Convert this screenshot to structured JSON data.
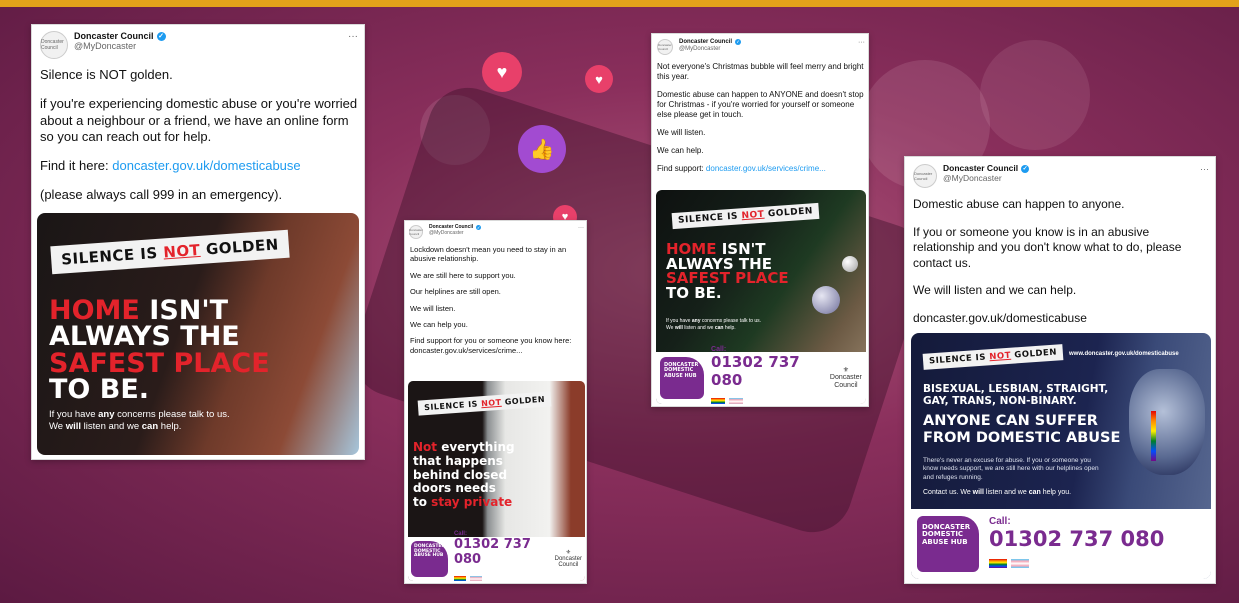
{
  "colors": {
    "accent_bar": "#e3a21a",
    "brand_purple": "#7a2b8f",
    "alert_red": "#e3232b",
    "link_blue": "#1d9bf0"
  },
  "account": {
    "name": "Doncaster Council",
    "handle": "@MyDoncaster",
    "logo_text": "Doncaster Council",
    "verified_icon": "verified-badge-icon",
    "more": "···"
  },
  "tweet1": {
    "line1": "Silence is NOT golden.",
    "line2": "if you're experiencing domestic abuse or you're worried about a neighbour or a friend, we have an online form so you can reach out for help.",
    "line3_prefix": "Find it here: ",
    "line3_link": "doncaster.gov.uk/domesticabuse",
    "line4": "(please always call 999 in an emergency).",
    "image": {
      "banner_a": "SILENCE IS ",
      "banner_b": "NOT",
      "banner_c": " GOLDEN",
      "h1_red": "HOME",
      "h1_rest": " ISN'T",
      "h2": "ALWAYS THE",
      "h3": "SAFEST PLACE",
      "h4": "TO BE.",
      "small1_a": "If you have ",
      "small1_b": "any",
      "small1_c": " concerns please talk to us.",
      "small2_a": "We ",
      "small2_b": "will",
      "small2_c": " listen and we ",
      "small2_d": "can",
      "small2_e": " help."
    }
  },
  "tweet2": {
    "p1": "Lockdown doesn't mean you need to stay in an abusive relationship.",
    "p2": "We are still here to support you.",
    "p3": "Our helplines are still open.",
    "p4": "We will listen.",
    "p5": "We can help you.",
    "p6": "Find support for you or someone you know here:",
    "link": "doncaster.gov.uk/services/crime...",
    "image": {
      "banner_a": "SILENCE IS ",
      "banner_b": "NOT",
      "banner_c": " GOLDEN",
      "l1_red": "Not",
      "l1_rest": " everything",
      "l2": "that happens",
      "l3": "behind closed",
      "l4": "doors needs",
      "l5_a": "to ",
      "l5_red": "stay private",
      "hub": "DONCASTER DOMESTIC ABUSE HUB",
      "call": "Call:",
      "number": "01302 737 080",
      "crest": "Doncaster Council"
    }
  },
  "tweet3": {
    "p1": "Not everyone's Christmas bubble will feel merry and bright this year.",
    "p2": "Domestic abuse can happen to ANYONE and doesn't stop for Christmas - if you're worried for yourself or someone else please get in touch.",
    "p3": "We will listen.",
    "p4": "We can help.",
    "p5_prefix": "Find support: ",
    "p5_link": "doncaster.gov.uk/services/crime...",
    "image": {
      "banner_a": "SILENCE IS ",
      "banner_b": "NOT",
      "banner_c": " GOLDEN",
      "h1_red": "HOME",
      "h1_rest": " ISN'T",
      "h2": "ALWAYS THE",
      "h3": "SAFEST PLACE",
      "h4": "TO BE.",
      "small1_a": "If you have ",
      "small1_b": "any",
      "small1_c": " concerns please talk to us.",
      "small2_a": "We ",
      "small2_b": "will",
      "small2_c": " listen and we ",
      "small2_d": "can",
      "small2_e": " help.",
      "hub": "DONCASTER DOMESTIC ABUSE HUB",
      "call": "Call:",
      "number": "01302 737 080",
      "crest": "Doncaster Council"
    }
  },
  "tweet4": {
    "p1": "Domestic abuse can happen to anyone.",
    "p2": "If you or someone you know is in an abusive relationship and you don't know what to do, please contact us.",
    "p3": "We will listen and we can help.",
    "link": "doncaster.gov.uk/domesticabuse",
    "image": {
      "banner_a": "SILENCE IS ",
      "banner_b": "NOT",
      "banner_c": " GOLDEN",
      "url": "www.doncaster.gov.uk/domesticabuse",
      "sub1": "BISEXUAL, LESBIAN, STRAIGHT,",
      "sub2": "GAY, TRANS, NON-BINARY.",
      "h1": "ANYONE CAN SUFFER",
      "h2": "FROM DOMESTIC ABUSE",
      "body": "There's never an excuse for abuse. If you or someone you know needs support, we are still here with our helplines open and refuges running.",
      "contact_a": "Contact us. We ",
      "contact_b": "will",
      "contact_c": " listen and we ",
      "contact_d": "can",
      "contact_e": " help you.",
      "hub": "DONCASTER DOMESTIC ABUSE HUB",
      "call": "Call:",
      "number": "01302 737 080"
    }
  }
}
